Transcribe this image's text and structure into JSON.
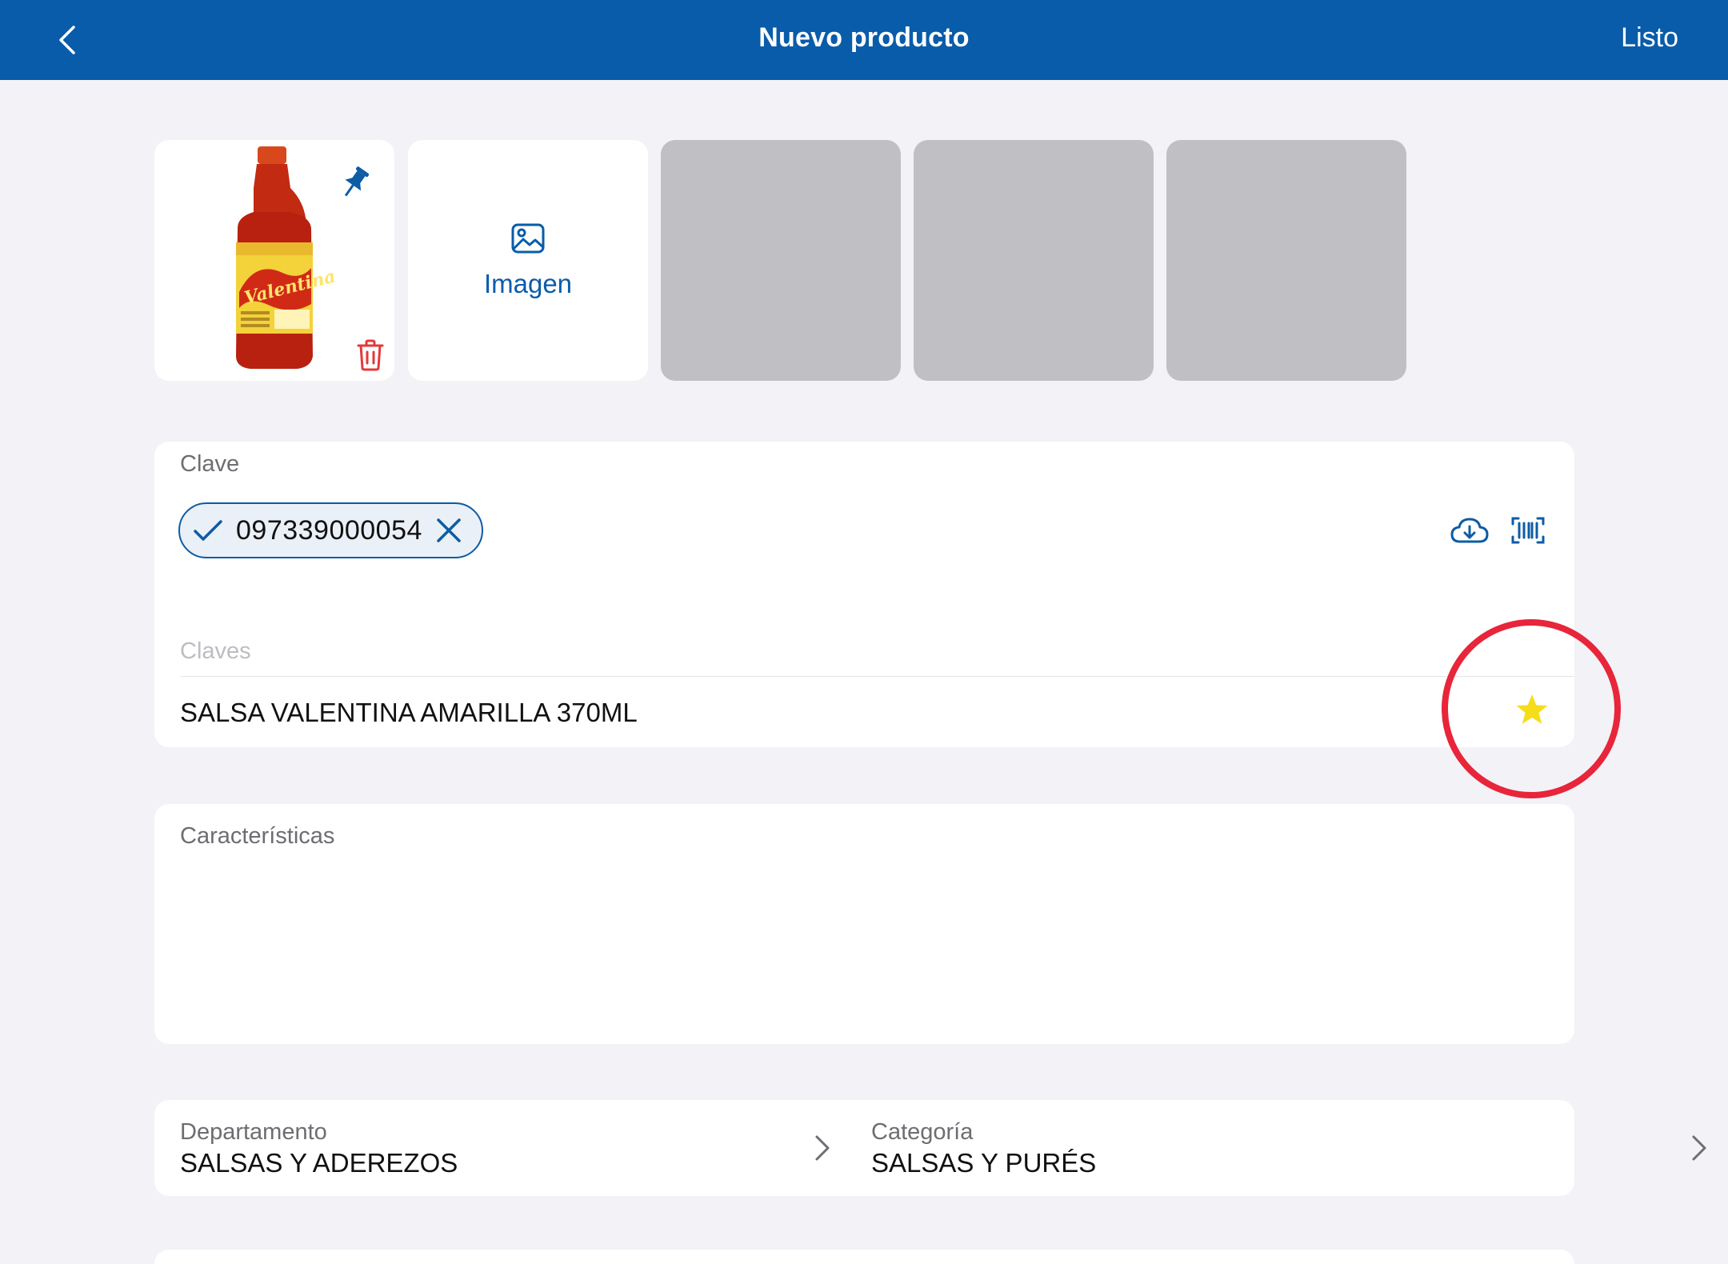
{
  "header": {
    "title": "Nuevo producto",
    "done_label": "Listo",
    "bg_color": "#095caa"
  },
  "images": {
    "add_label": "Imagen",
    "placeholder_count": 3
  },
  "codes": {
    "label": "Clave",
    "chip_value": "097339000054",
    "secondary_label": "Claves",
    "product_name": "SALSA VALENTINA AMARILLA 370ML",
    "star_color": "#f5dd1c",
    "highlight_color": "#e8253a"
  },
  "features": {
    "label": "Características"
  },
  "classification": {
    "department_label": "Departamento",
    "department_value": "SALSAS Y ADEREZOS",
    "category_label": "Categoría",
    "category_value": "SALSAS Y PURÉS"
  }
}
